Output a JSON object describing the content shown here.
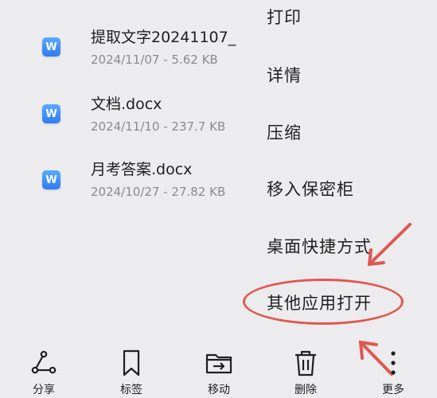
{
  "files": [
    {
      "name": "提取文字20241107_",
      "meta": "2024/11/07 - 5.62 KB",
      "icon": "word-doc-icon",
      "icon_letter": "W"
    },
    {
      "name": "文档.docx",
      "meta": "2024/11/10 - 237.7 KB",
      "icon": "word-doc-icon",
      "icon_letter": "W"
    },
    {
      "name": "月考答案.docx",
      "meta": "2024/10/27 - 27.82 KB",
      "icon": "word-doc-icon",
      "icon_letter": "W"
    }
  ],
  "menu": {
    "items": [
      {
        "label": "打印"
      },
      {
        "label": "详情"
      },
      {
        "label": "压缩"
      },
      {
        "label": "移入保密柜"
      },
      {
        "label": "桌面快捷方式"
      },
      {
        "label": "其他应用打开"
      }
    ]
  },
  "toolbar": {
    "items": [
      {
        "label": "分享",
        "icon": "share-icon"
      },
      {
        "label": "标签",
        "icon": "bookmark-icon"
      },
      {
        "label": "移动",
        "icon": "move-folder-icon"
      },
      {
        "label": "删除",
        "icon": "trash-icon"
      },
      {
        "label": "更多",
        "icon": "more-vertical-icon"
      }
    ]
  },
  "colors": {
    "background": "#ececee",
    "annotation_red": "#e0584f",
    "word_icon_blue": "#2f7cf0"
  }
}
